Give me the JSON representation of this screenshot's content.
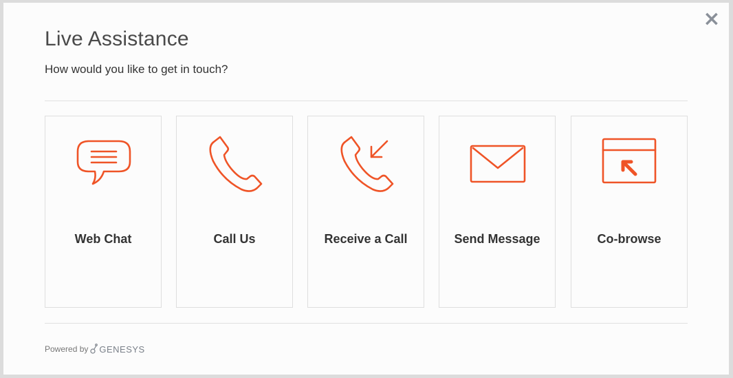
{
  "dialog": {
    "title": "Live Assistance",
    "subtitle": "How would you like to get in touch?",
    "close_icon": "close-icon"
  },
  "options": [
    {
      "label": "Web Chat",
      "icon": "chat-bubble-icon"
    },
    {
      "label": "Call Us",
      "icon": "phone-icon"
    },
    {
      "label": "Receive a Call",
      "icon": "phone-incoming-icon"
    },
    {
      "label": "Send Message",
      "icon": "envelope-icon"
    },
    {
      "label": "Co-browse",
      "icon": "cobrowse-window-icon"
    }
  ],
  "footer": {
    "powered_by": "Powered by",
    "brand": "GENESYS"
  },
  "colors": {
    "accent": "#ef5427",
    "text": "#333333",
    "border": "#dedede"
  }
}
